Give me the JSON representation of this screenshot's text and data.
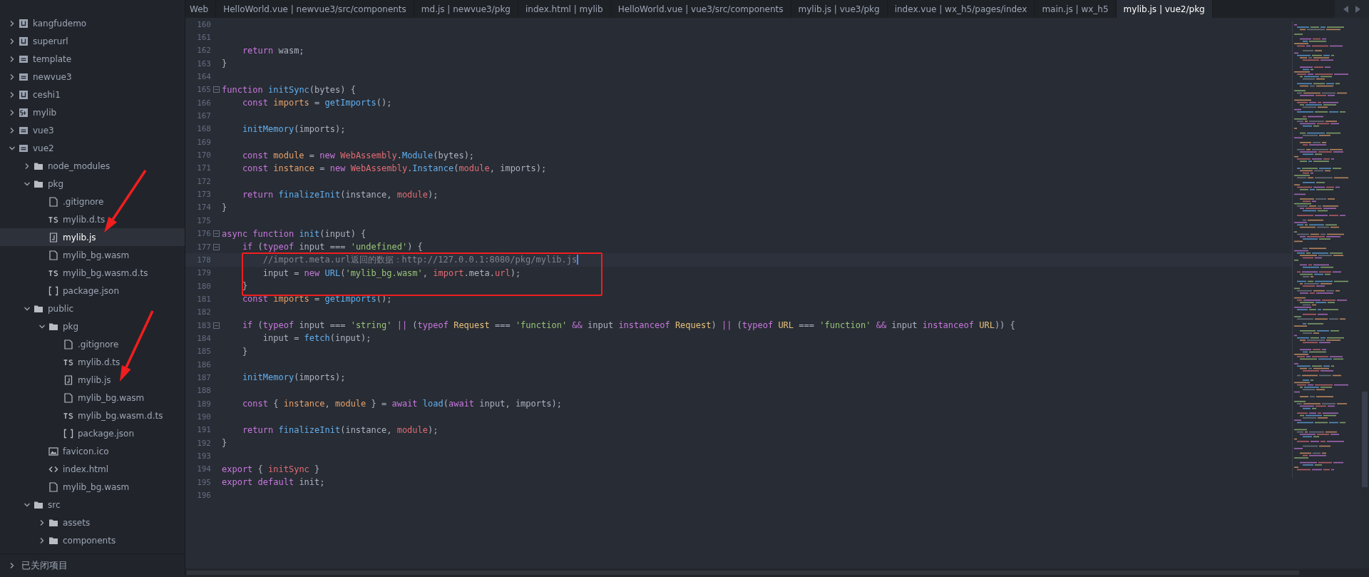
{
  "sidebar": {
    "tree": [
      {
        "label": "kangfudemo",
        "kind": "uni",
        "expanded": false,
        "selected": false
      },
      {
        "label": "superurl",
        "kind": "uni",
        "expanded": false,
        "selected": false
      },
      {
        "label": "template",
        "kind": "project",
        "expanded": false,
        "selected": false
      },
      {
        "label": "newvue3",
        "kind": "project",
        "expanded": false,
        "selected": false
      },
      {
        "label": "ceshi1",
        "kind": "uni",
        "expanded": false,
        "selected": false
      },
      {
        "label": "mylib",
        "kind": "h5",
        "expanded": false,
        "selected": false
      },
      {
        "label": "vue3",
        "kind": "project",
        "expanded": false,
        "selected": false
      },
      {
        "label": "vue2",
        "kind": "project",
        "expanded": true,
        "selected": false,
        "children": [
          {
            "label": "node_modules",
            "kind": "folder",
            "expanded": false,
            "selected": false
          },
          {
            "label": "pkg",
            "kind": "folder",
            "expanded": true,
            "selected": false,
            "children": [
              {
                "label": ".gitignore",
                "kind": "file",
                "selected": false
              },
              {
                "label": "mylib.d.ts",
                "kind": "ts",
                "selected": false
              },
              {
                "label": "mylib.js",
                "kind": "js",
                "selected": true
              },
              {
                "label": "mylib_bg.wasm",
                "kind": "file",
                "selected": false
              },
              {
                "label": "mylib_bg.wasm.d.ts",
                "kind": "ts",
                "selected": false
              },
              {
                "label": "package.json",
                "kind": "json",
                "selected": false
              }
            ]
          },
          {
            "label": "public",
            "kind": "folder",
            "expanded": true,
            "selected": false,
            "children": [
              {
                "label": "pkg",
                "kind": "folder",
                "expanded": true,
                "selected": false,
                "children": [
                  {
                    "label": ".gitignore",
                    "kind": "file",
                    "selected": false
                  },
                  {
                    "label": "mylib.d.ts",
                    "kind": "ts",
                    "selected": false
                  },
                  {
                    "label": "mylib.js",
                    "kind": "js",
                    "selected": false
                  },
                  {
                    "label": "mylib_bg.wasm",
                    "kind": "file",
                    "selected": false
                  },
                  {
                    "label": "mylib_bg.wasm.d.ts",
                    "kind": "ts",
                    "selected": false
                  },
                  {
                    "label": "package.json",
                    "kind": "json",
                    "selected": false
                  }
                ]
              },
              {
                "label": "favicon.ico",
                "kind": "image",
                "selected": false
              },
              {
                "label": "index.html",
                "kind": "html",
                "selected": false
              },
              {
                "label": "mylib_bg.wasm",
                "kind": "file",
                "selected": false
              }
            ]
          },
          {
            "label": "src",
            "kind": "folder",
            "expanded": true,
            "selected": false,
            "children": [
              {
                "label": "assets",
                "kind": "folder",
                "expanded": false,
                "selected": false
              },
              {
                "label": "components",
                "kind": "folder",
                "expanded": false,
                "selected": false
              }
            ]
          }
        ]
      }
    ],
    "closed_projects": {
      "label": "已关闭项目",
      "expanded": false
    }
  },
  "tabs": [
    {
      "label": "Web",
      "selected": false
    },
    {
      "label": "HelloWorld.vue | newvue3/src/components",
      "selected": false
    },
    {
      "label": "md.js | newvue3/pkg",
      "selected": false
    },
    {
      "label": "index.html | mylib",
      "selected": false
    },
    {
      "label": "HelloWorld.vue | vue3/src/components",
      "selected": false
    },
    {
      "label": "mylib.js | vue3/pkg",
      "selected": false
    },
    {
      "label": "index.vue | wx_h5/pages/index",
      "selected": false
    },
    {
      "label": "main.js | wx_h5",
      "selected": false
    },
    {
      "label": "mylib.js | vue2/pkg",
      "selected": true
    }
  ],
  "editor": {
    "lines": [
      {
        "number": "160",
        "fold": false,
        "current": false
      },
      {
        "number": "161",
        "fold": false,
        "current": false
      },
      {
        "number": "162",
        "fold": false,
        "current": false,
        "tokens": [
          {
            "kind": "keyword",
            "text": "    return"
          },
          {
            "kind": "plain",
            "text": " wasm;"
          }
        ]
      },
      {
        "number": "163",
        "fold": false,
        "current": false,
        "tokens": [
          {
            "kind": "plain",
            "text": "}"
          }
        ]
      },
      {
        "number": "164",
        "fold": false,
        "current": false
      },
      {
        "number": "165",
        "fold": true,
        "current": false,
        "tokens": [
          {
            "kind": "keyword",
            "text": "function "
          },
          {
            "kind": "function",
            "text": "initSync"
          },
          {
            "kind": "plain",
            "text": "(bytes) {"
          }
        ]
      },
      {
        "number": "166",
        "fold": false,
        "current": false,
        "tokens": [
          {
            "kind": "keyword",
            "text": "    const "
          },
          {
            "kind": "variable",
            "text": "imports"
          },
          {
            "kind": "plain",
            "text": " = "
          },
          {
            "kind": "function",
            "text": "getImports"
          },
          {
            "kind": "plain",
            "text": "();"
          }
        ]
      },
      {
        "number": "167",
        "fold": false,
        "current": false
      },
      {
        "number": "168",
        "fold": false,
        "current": false,
        "tokens": [
          {
            "kind": "function",
            "text": "    initMemory"
          },
          {
            "kind": "plain",
            "text": "(imports);"
          }
        ]
      },
      {
        "number": "169",
        "fold": false,
        "current": false
      },
      {
        "number": "170",
        "fold": false,
        "current": false,
        "tokens": [
          {
            "kind": "keyword",
            "text": "    const "
          },
          {
            "kind": "variable",
            "text": "module"
          },
          {
            "kind": "plain",
            "text": " = "
          },
          {
            "kind": "keyword",
            "text": "new "
          },
          {
            "kind": "class",
            "text": "WebAssembly"
          },
          {
            "kind": "plain",
            "text": "."
          },
          {
            "kind": "function",
            "text": "Module"
          },
          {
            "kind": "plain",
            "text": "(bytes);"
          }
        ]
      },
      {
        "number": "171",
        "fold": false,
        "current": false,
        "tokens": [
          {
            "kind": "keyword",
            "text": "    const "
          },
          {
            "kind": "variable",
            "text": "instance"
          },
          {
            "kind": "plain",
            "text": " = "
          },
          {
            "kind": "keyword",
            "text": "new "
          },
          {
            "kind": "class",
            "text": "WebAssembly"
          },
          {
            "kind": "plain",
            "text": "."
          },
          {
            "kind": "function",
            "text": "Instance"
          },
          {
            "kind": "plain",
            "text": "("
          },
          {
            "kind": "class",
            "text": "module"
          },
          {
            "kind": "plain",
            "text": ", imports);"
          }
        ]
      },
      {
        "number": "172",
        "fold": false,
        "current": false
      },
      {
        "number": "173",
        "fold": false,
        "current": false,
        "tokens": [
          {
            "kind": "keyword",
            "text": "    return "
          },
          {
            "kind": "function",
            "text": "finalizeInit"
          },
          {
            "kind": "plain",
            "text": "(instance, "
          },
          {
            "kind": "class",
            "text": "module"
          },
          {
            "kind": "plain",
            "text": ");"
          }
        ]
      },
      {
        "number": "174",
        "fold": false,
        "current": false,
        "tokens": [
          {
            "kind": "plain",
            "text": "}"
          }
        ]
      },
      {
        "number": "175",
        "fold": false,
        "current": false
      },
      {
        "number": "176",
        "fold": true,
        "current": false,
        "tokens": [
          {
            "kind": "keyword",
            "text": "async function "
          },
          {
            "kind": "function",
            "text": "init"
          },
          {
            "kind": "plain",
            "text": "(input) {"
          }
        ]
      },
      {
        "number": "177",
        "fold": true,
        "current": false,
        "tokens": [
          {
            "kind": "keyword",
            "text": "    if"
          },
          {
            "kind": "plain",
            "text": " ("
          },
          {
            "kind": "keyword",
            "text": "typeof"
          },
          {
            "kind": "plain",
            "text": " input === "
          },
          {
            "kind": "string",
            "text": "'undefined'"
          },
          {
            "kind": "plain",
            "text": ") {"
          }
        ]
      },
      {
        "number": "178",
        "fold": false,
        "current": true,
        "tokens": [
          {
            "kind": "comment",
            "text": "        //import.meta.url返回的数据：http://127.0.0.1:8080/pkg/mylib.js"
          }
        ]
      },
      {
        "number": "179",
        "fold": false,
        "current": false,
        "tokens": [
          {
            "kind": "plain",
            "text": "        input = "
          },
          {
            "kind": "keyword",
            "text": "new "
          },
          {
            "kind": "function",
            "text": "URL"
          },
          {
            "kind": "plain",
            "text": "("
          },
          {
            "kind": "string",
            "text": "'mylib_bg.wasm'"
          },
          {
            "kind": "plain",
            "text": ", "
          },
          {
            "kind": "class",
            "text": "import"
          },
          {
            "kind": "plain",
            "text": ".meta."
          },
          {
            "kind": "class",
            "text": "url"
          },
          {
            "kind": "plain",
            "text": ");"
          }
        ]
      },
      {
        "number": "180",
        "fold": false,
        "current": false,
        "tokens": [
          {
            "kind": "plain",
            "text": "    }"
          }
        ]
      },
      {
        "number": "181",
        "fold": false,
        "current": false,
        "tokens": [
          {
            "kind": "keyword",
            "text": "    const "
          },
          {
            "kind": "variable",
            "text": "imports"
          },
          {
            "kind": "plain",
            "text": " = "
          },
          {
            "kind": "function",
            "text": "getImports"
          },
          {
            "kind": "plain",
            "text": "();"
          }
        ]
      },
      {
        "number": "182",
        "fold": false,
        "current": false
      },
      {
        "number": "183",
        "fold": true,
        "current": false,
        "tokens": [
          {
            "kind": "keyword",
            "text": "    if"
          },
          {
            "kind": "plain",
            "text": " ("
          },
          {
            "kind": "keyword",
            "text": "typeof"
          },
          {
            "kind": "plain",
            "text": " input === "
          },
          {
            "kind": "string",
            "text": "'string'"
          },
          {
            "kind": "keyword",
            "text": " ||"
          },
          {
            "kind": "plain",
            "text": " ("
          },
          {
            "kind": "keyword",
            "text": "typeof "
          },
          {
            "kind": "type",
            "text": "Request"
          },
          {
            "kind": "plain",
            "text": " === "
          },
          {
            "kind": "string",
            "text": "'function'"
          },
          {
            "kind": "keyword",
            "text": " &&"
          },
          {
            "kind": "plain",
            "text": " input "
          },
          {
            "kind": "keyword",
            "text": "instanceof "
          },
          {
            "kind": "type",
            "text": "Request"
          },
          {
            "kind": "plain",
            "text": ") "
          },
          {
            "kind": "keyword",
            "text": "||"
          },
          {
            "kind": "plain",
            "text": " ("
          },
          {
            "kind": "keyword",
            "text": "typeof "
          },
          {
            "kind": "type",
            "text": "URL"
          },
          {
            "kind": "plain",
            "text": " === "
          },
          {
            "kind": "string",
            "text": "'function'"
          },
          {
            "kind": "keyword",
            "text": " &&"
          },
          {
            "kind": "plain",
            "text": " input "
          },
          {
            "kind": "keyword",
            "text": "instanceof "
          },
          {
            "kind": "type",
            "text": "URL"
          },
          {
            "kind": "plain",
            "text": ")) {"
          }
        ]
      },
      {
        "number": "184",
        "fold": false,
        "current": false,
        "tokens": [
          {
            "kind": "plain",
            "text": "        input = "
          },
          {
            "kind": "function",
            "text": "fetch"
          },
          {
            "kind": "plain",
            "text": "(input);"
          }
        ]
      },
      {
        "number": "185",
        "fold": false,
        "current": false,
        "tokens": [
          {
            "kind": "plain",
            "text": "    }"
          }
        ]
      },
      {
        "number": "186",
        "fold": false,
        "current": false
      },
      {
        "number": "187",
        "fold": false,
        "current": false,
        "tokens": [
          {
            "kind": "function",
            "text": "    initMemory"
          },
          {
            "kind": "plain",
            "text": "(imports);"
          }
        ]
      },
      {
        "number": "188",
        "fold": false,
        "current": false
      },
      {
        "number": "189",
        "fold": false,
        "current": false,
        "tokens": [
          {
            "kind": "keyword",
            "text": "    const"
          },
          {
            "kind": "plain",
            "text": " { "
          },
          {
            "kind": "variable",
            "text": "instance"
          },
          {
            "kind": "plain",
            "text": ", "
          },
          {
            "kind": "variable",
            "text": "module"
          },
          {
            "kind": "plain",
            "text": " } = "
          },
          {
            "kind": "keyword",
            "text": "await "
          },
          {
            "kind": "function",
            "text": "load"
          },
          {
            "kind": "plain",
            "text": "("
          },
          {
            "kind": "keyword",
            "text": "await"
          },
          {
            "kind": "plain",
            "text": " input, imports);"
          }
        ]
      },
      {
        "number": "190",
        "fold": false,
        "current": false
      },
      {
        "number": "191",
        "fold": false,
        "current": false,
        "tokens": [
          {
            "kind": "keyword",
            "text": "    return "
          },
          {
            "kind": "function",
            "text": "finalizeInit"
          },
          {
            "kind": "plain",
            "text": "(instance, "
          },
          {
            "kind": "class",
            "text": "module"
          },
          {
            "kind": "plain",
            "text": ");"
          }
        ]
      },
      {
        "number": "192",
        "fold": false,
        "current": false,
        "tokens": [
          {
            "kind": "plain",
            "text": "}"
          }
        ]
      },
      {
        "number": "193",
        "fold": false,
        "current": false
      },
      {
        "number": "194",
        "fold": false,
        "current": false,
        "tokens": [
          {
            "kind": "keyword",
            "text": "export"
          },
          {
            "kind": "plain",
            "text": " { "
          },
          {
            "kind": "class",
            "text": "initSync"
          },
          {
            "kind": "plain",
            "text": " }"
          }
        ]
      },
      {
        "number": "195",
        "fold": false,
        "current": false,
        "tokens": [
          {
            "kind": "keyword",
            "text": "export default"
          },
          {
            "kind": "plain",
            "text": " init;"
          }
        ]
      },
      {
        "number": "196",
        "fold": false,
        "current": false
      }
    ]
  }
}
